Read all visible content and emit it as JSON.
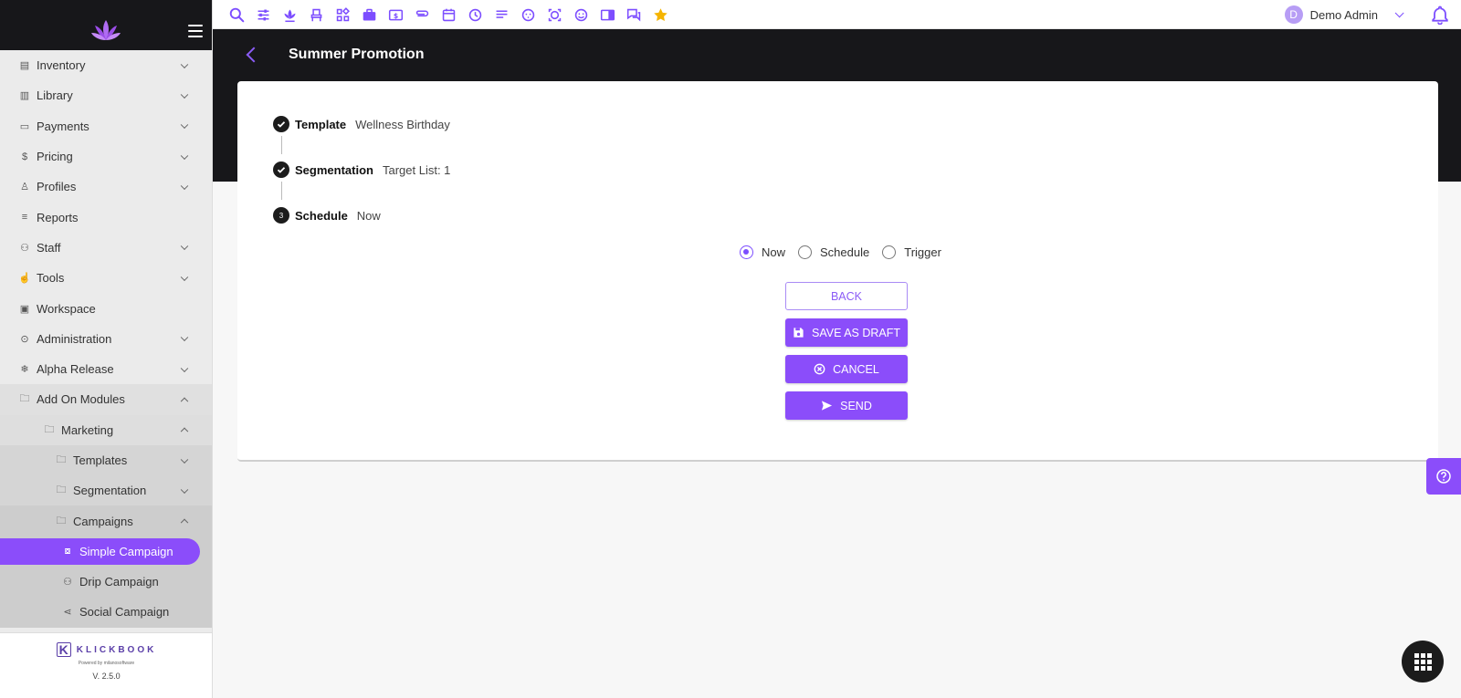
{
  "sidebar": {
    "items": [
      {
        "label": "Inventory",
        "icon": "inventory-icon"
      },
      {
        "label": "Library",
        "icon": "library-icon"
      },
      {
        "label": "Payments",
        "icon": "payments-icon"
      },
      {
        "label": "Pricing",
        "icon": "dollar-icon"
      },
      {
        "label": "Profiles",
        "icon": "profile-icon"
      },
      {
        "label": "Reports",
        "icon": "reports-icon"
      },
      {
        "label": "Staff",
        "icon": "staff-icon"
      },
      {
        "label": "Tools",
        "icon": "hand-icon"
      },
      {
        "label": "Workspace",
        "icon": "workspace-icon"
      },
      {
        "label": "Administration",
        "icon": "admin-icon"
      },
      {
        "label": "Alpha Release",
        "icon": "snowflake-icon"
      },
      {
        "label": "Add On Modules",
        "icon": "folder-icon"
      },
      {
        "label": "Marketing",
        "icon": "folder-icon"
      },
      {
        "label": "Templates",
        "icon": "folder-icon"
      },
      {
        "label": "Segmentation",
        "icon": "folder-icon"
      },
      {
        "label": "Campaigns",
        "icon": "folder-icon"
      },
      {
        "label": "Simple Campaign",
        "icon": "campaign-icon"
      },
      {
        "label": "Drip Campaign",
        "icon": "people-icon"
      },
      {
        "label": "Social Campaign",
        "icon": "share-icon"
      }
    ],
    "footer": {
      "brand_mark": "K",
      "brand": "KLICKBOOK",
      "powered": "Powered by milanosoftware",
      "version": "V. 2.5.0"
    }
  },
  "topbar": {
    "user_initial": "D",
    "user_name": "Demo Admin"
  },
  "page": {
    "title": "Summer Promotion"
  },
  "steps": [
    {
      "title": "Template",
      "value": "Wellness Birthday",
      "status": "done"
    },
    {
      "title": "Segmentation",
      "value": "Target List: 1",
      "status": "done"
    },
    {
      "number": "3",
      "title": "Schedule",
      "value": "Now",
      "status": "current"
    }
  ],
  "schedule_options": [
    {
      "label": "Now",
      "selected": true
    },
    {
      "label": "Schedule",
      "selected": false
    },
    {
      "label": "Trigger",
      "selected": false
    }
  ],
  "buttons": {
    "back": "BACK",
    "save_draft": "SAVE AS DRAFT",
    "cancel": "CANCEL",
    "send": "SEND"
  },
  "colors": {
    "accent": "#8b4dfa",
    "dark": "#17171a",
    "star": "#f5b400"
  }
}
